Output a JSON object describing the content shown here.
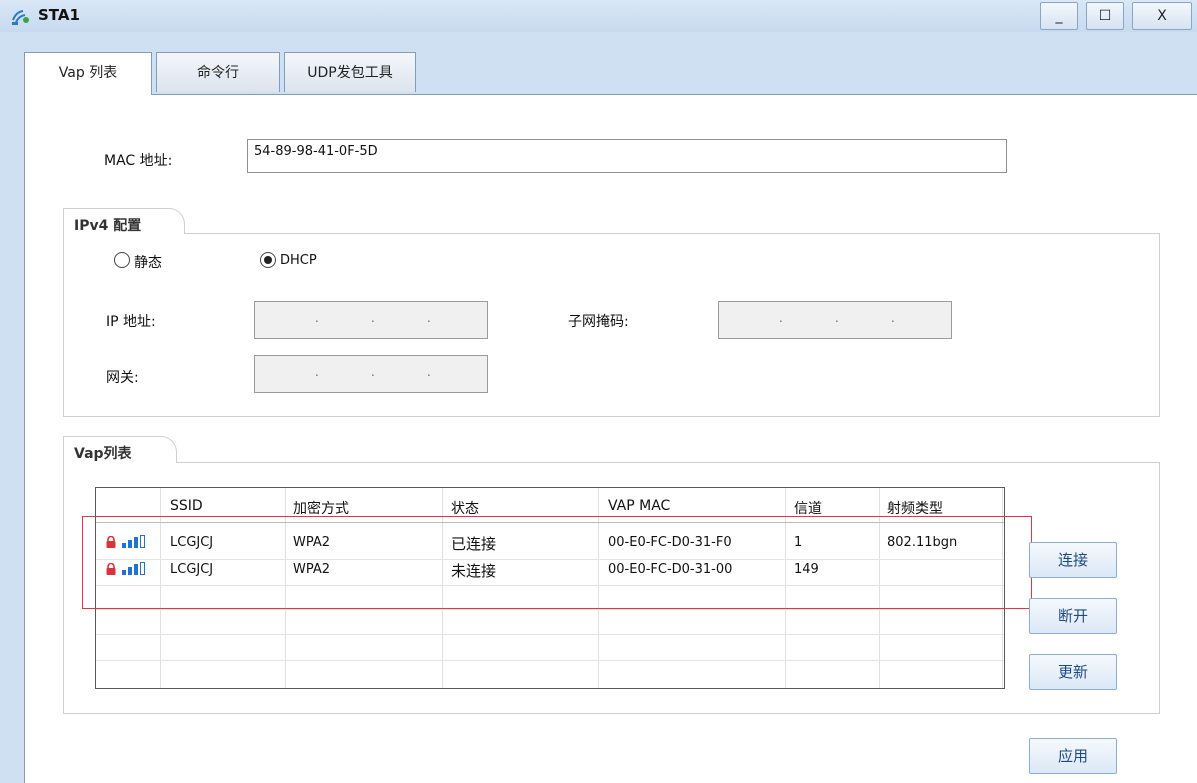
{
  "window": {
    "title": "STA1",
    "minimize": "_",
    "maximize": "☐",
    "close": "X"
  },
  "tabs": [
    {
      "label": "Vap 列表"
    },
    {
      "label": "命令行"
    },
    {
      "label": "UDP发包工具"
    }
  ],
  "mac": {
    "label": "MAC 地址:",
    "value": "54-89-98-41-0F-5D"
  },
  "ipv4": {
    "group_title": "IPv4 配置",
    "static_label": "静态",
    "dhcp_label": "DHCP",
    "mode": "DHCP",
    "ip_label": "IP 地址:",
    "mask_label": "子网掩码:",
    "gateway_label": "网关:",
    "dot": "."
  },
  "vap": {
    "group_title": "Vap列表",
    "columns": [
      "SSID",
      "加密方式",
      "状态",
      "VAP MAC",
      "信道",
      "射频类型"
    ],
    "rows": [
      {
        "ssid": "LCGJCJ",
        "encryption": "WPA2",
        "status": "已连接",
        "vap_mac": "00-E0-FC-D0-31-F0",
        "channel": "1",
        "radio": "802.11bgn",
        "signal_bars": 3,
        "locked": true
      },
      {
        "ssid": "LCGJCJ",
        "encryption": "WPA2",
        "status": "未连接",
        "vap_mac": "00-E0-FC-D0-31-00",
        "channel": "149",
        "radio": "",
        "signal_bars": 3,
        "locked": true
      }
    ]
  },
  "buttons": {
    "connect": "连接",
    "disconnect": "断开",
    "refresh": "更新",
    "apply": "应用"
  },
  "colors": {
    "accent": "#1e73d8",
    "highlight": "#e0383e",
    "lock": "#d9343a"
  }
}
